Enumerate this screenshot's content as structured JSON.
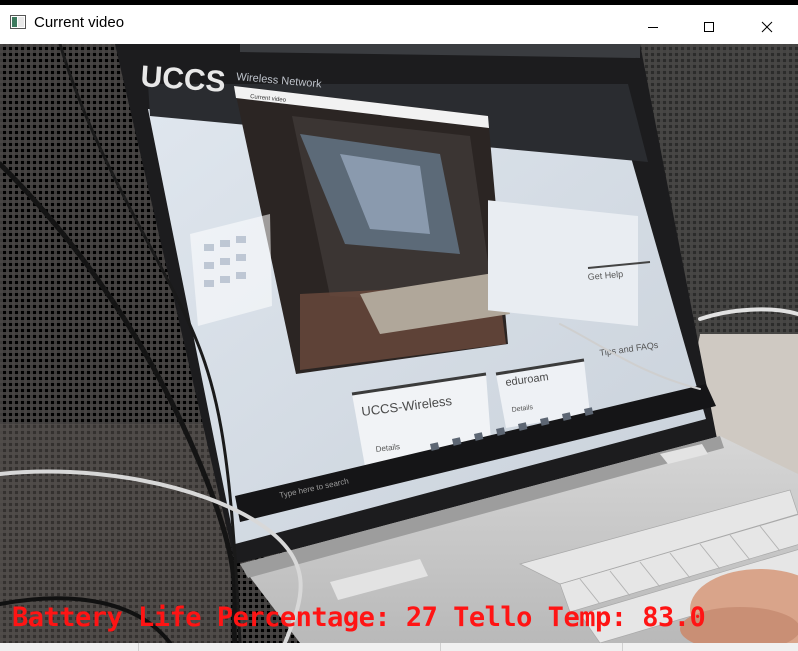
{
  "window": {
    "title": "Current video",
    "icon": "window-app-icon",
    "controls": {
      "minimize_icon": "minimize-icon",
      "maximize_icon": "maximize-icon",
      "close_icon": "close-icon"
    }
  },
  "video": {
    "overlay_text": "Battery Life Percentage: 27 Tello Temp: 83.0",
    "overlay_color": "#ff1414",
    "screen_labels": {
      "brand": "UCCS",
      "brand_sub": "Wireless Network",
      "inner_window_title": "Current video",
      "card1_title": "UCCS-Wireless",
      "card1_link": "Details",
      "card2_title": "eduroam",
      "card2_link": "Details",
      "side_heading": "Get Help",
      "side_item": "Tips and FAQs",
      "search_placeholder": "Type here to search"
    }
  },
  "colors": {
    "titlebar_bg": "#ffffff",
    "laptop_bezel": "#1c1c1e",
    "laptop_body": "#cfcfcf",
    "screen_bg": "#e6eaf0",
    "fabric": "#3f3d3c"
  }
}
